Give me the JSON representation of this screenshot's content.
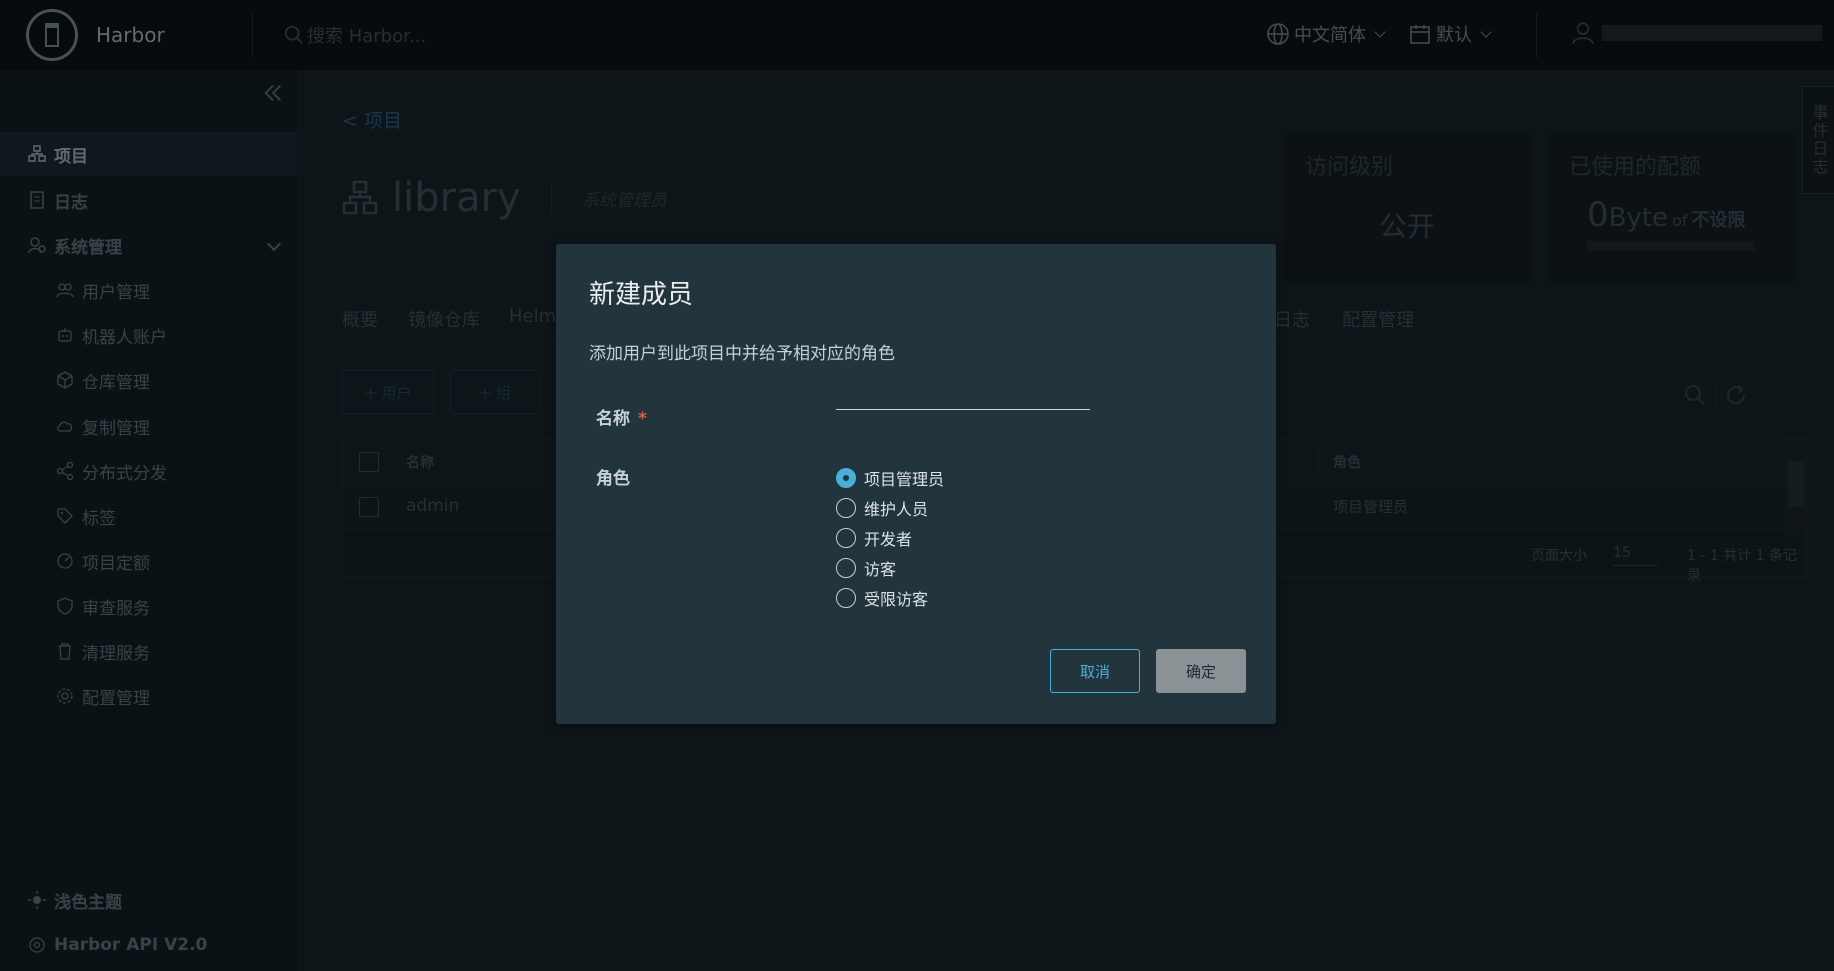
{
  "header": {
    "brand": "Harbor",
    "search_placeholder": "搜索 Harbor...",
    "language": "中文简体",
    "theme_default": "默认"
  },
  "sidebar": {
    "items": [
      {
        "label": "项目",
        "icon": "projects-icon"
      },
      {
        "label": "日志",
        "icon": "logs-icon"
      },
      {
        "label": "系统管理",
        "icon": "admin-icon"
      },
      {
        "label": "用户管理",
        "icon": "users-icon"
      },
      {
        "label": "机器人账户",
        "icon": "robot-icon"
      },
      {
        "label": "仓库管理",
        "icon": "registry-icon"
      },
      {
        "label": "复制管理",
        "icon": "replication-icon"
      },
      {
        "label": "分布式分发",
        "icon": "distribution-icon"
      },
      {
        "label": "标签",
        "icon": "tag-icon"
      },
      {
        "label": "项目定额",
        "icon": "quota-icon"
      },
      {
        "label": "审查服务",
        "icon": "shield-icon"
      },
      {
        "label": "清理服务",
        "icon": "trash-icon"
      },
      {
        "label": "配置管理",
        "icon": "gear-icon"
      }
    ],
    "light_theme": "浅色主题",
    "api": "Harbor API V2.0"
  },
  "main": {
    "back": "< 项目",
    "project_name": "library",
    "project_role": "系统管理员",
    "access_level_title": "访问级别",
    "access_level_value": "公开",
    "quota_title": "已使用的配额",
    "quota_num": "0",
    "quota_unit": "Byte",
    "quota_of": "of",
    "quota_limit": "不设限",
    "tabs": [
      "概要",
      "镜像仓库",
      "Helm",
      "日志",
      "配置管理"
    ],
    "btn_user": "+ 用户",
    "btn_group": "+ 组",
    "grid": {
      "col_name": "名称",
      "col_role": "角色",
      "row_name": "admin",
      "row_role": "项目管理员",
      "page_size_label": "页面大小",
      "page_size": "15",
      "summary": "1 - 1 共计 1 条记录"
    },
    "side_tab": "事件日志"
  },
  "modal": {
    "title": "新建成员",
    "description": "添加用户到此项目中并给予相对应的角色",
    "name_label": "名称",
    "name_required": "*",
    "name_value": "",
    "role_label": "角色",
    "roles": [
      "项目管理员",
      "维护人员",
      "开发者",
      "访客",
      "受限访客"
    ],
    "selected_role": "项目管理员",
    "cancel": "取消",
    "ok": "确定"
  },
  "colors": {
    "accent": "#49afd9",
    "header_bg": "#0f171c",
    "modal_bg": "#22343c"
  }
}
